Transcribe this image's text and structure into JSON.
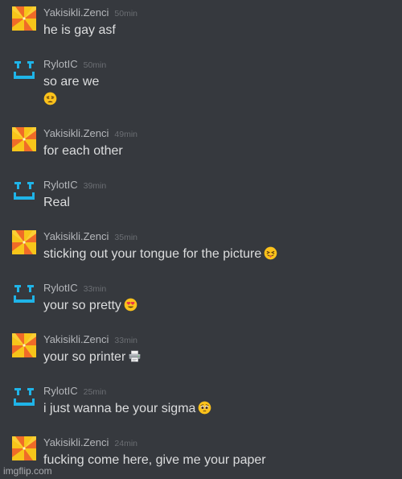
{
  "colors": {
    "background": "#36393e",
    "username": "#b5b7bb",
    "timestamp": "#6b6e73",
    "text": "#dcddde",
    "avatar_a_yellow": "#f7c51a",
    "avatar_a_orange": "#f06b28",
    "avatar_b_blue": "#1fb4e8"
  },
  "messages": [
    {
      "user": "Yakisikli.Zenci",
      "avatar": "pinwheel-avatar",
      "time": "50min",
      "text": "he is gay asf",
      "emoji": null,
      "emoji_line": null
    },
    {
      "user": "RylotIC",
      "avatar": "pixel-face-avatar",
      "time": "50min",
      "text": "so are we",
      "emoji": null,
      "emoji_line": "weary-face-emoji"
    },
    {
      "user": "Yakisikli.Zenci",
      "avatar": "pinwheel-avatar",
      "time": "49min",
      "text": "for each other",
      "emoji": null,
      "emoji_line": null
    },
    {
      "user": "RylotIC",
      "avatar": "pixel-face-avatar",
      "time": "39min",
      "text": "Real",
      "emoji": null,
      "emoji_line": null
    },
    {
      "user": "Yakisikli.Zenci",
      "avatar": "pinwheel-avatar",
      "time": "35min",
      "text": "sticking out your tongue for the picture",
      "emoji": "tongue-face-emoji",
      "emoji_line": null
    },
    {
      "user": "RylotIC",
      "avatar": "pixel-face-avatar",
      "time": "33min",
      "text": "your so pretty",
      "emoji": "heart-eyes-emoji",
      "emoji_line": null
    },
    {
      "user": "Yakisikli.Zenci",
      "avatar": "pinwheel-avatar",
      "time": "33min",
      "text": "your so printer",
      "emoji": "printer-emoji",
      "emoji_line": null
    },
    {
      "user": "RylotIC",
      "avatar": "pixel-face-avatar",
      "time": "25min",
      "text": "i just wanna be your sigma",
      "emoji": "pleading-face-emoji",
      "emoji_line": null
    },
    {
      "user": "Yakisikli.Zenci",
      "avatar": "pinwheel-avatar",
      "time": "24min",
      "text": "fucking come here, give me your paper",
      "emoji": null,
      "emoji_line": null
    }
  ],
  "watermark": "imgflip.com"
}
